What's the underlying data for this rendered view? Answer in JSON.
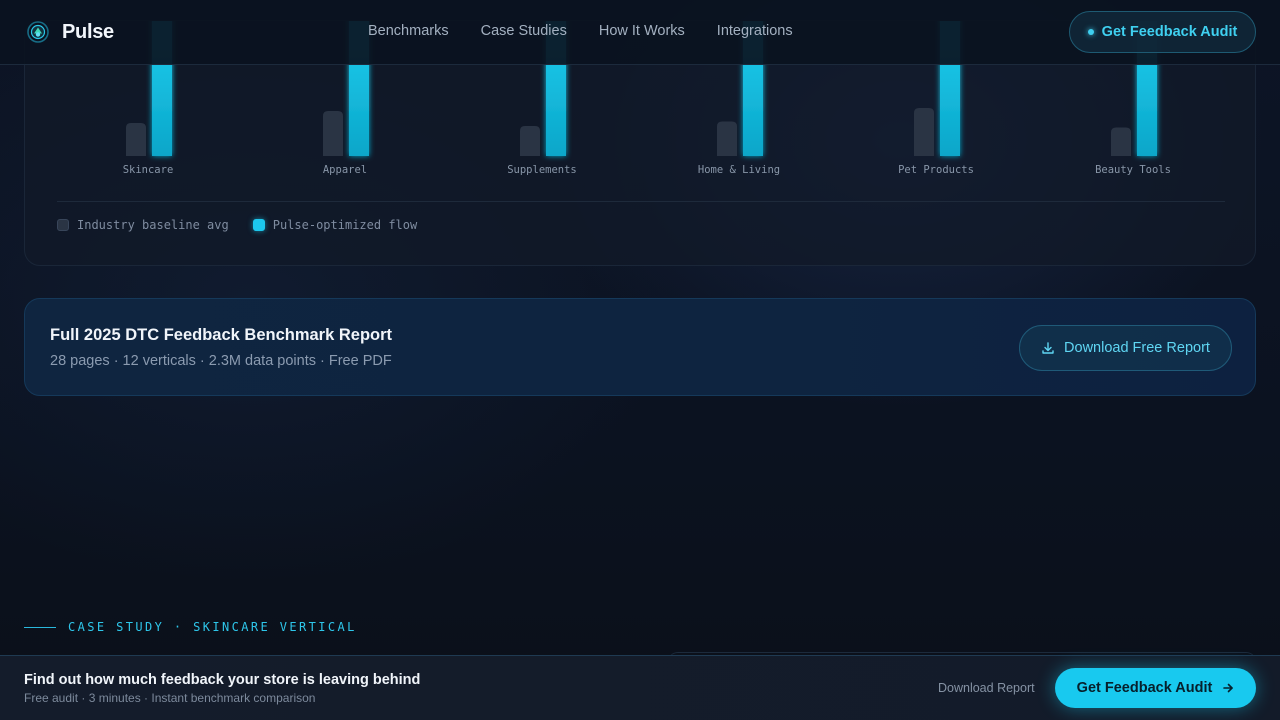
{
  "nav": {
    "brand": "Pulse",
    "links": [
      "Benchmarks",
      "Case Studies",
      "How It Works",
      "Integrations"
    ],
    "cta_label": "Get Feedback Audit"
  },
  "chart_data": {
    "type": "bar",
    "categories": [
      "Skincare",
      "Apparel",
      "Supplements",
      "Home & Living",
      "Pet Products",
      "Beauty Tools"
    ],
    "series": [
      {
        "name": "Industry baseline avg",
        "values": [
          22,
          30,
          20,
          23,
          32,
          19
        ],
        "color": "#2a3444"
      },
      {
        "name": "Pulse-optimized flow",
        "values": [
          100,
          100,
          100,
          100,
          100,
          100
        ],
        "color": "#1cc8ee"
      }
    ],
    "legend": [
      "Industry baseline avg",
      "Pulse-optimized flow"
    ],
    "legend_position": "bottom-left",
    "note": "bar tops cropped by the sticky header"
  },
  "report": {
    "title": "Full 2025 DTC Feedback Benchmark Report",
    "meta": "28 pages · 12 verticals · 2.3M data points · Free PDF",
    "button_label": "Download Free Report",
    "button_icon": "download-icon"
  },
  "case_study": {
    "eyebrow": "CASE STUDY · SKINCARE VERTICAL"
  },
  "bottom_bar": {
    "title": "Find out how much feedback your store is leaving behind",
    "subtitle": "Free audit · 3 minutes · Instant benchmark comparison",
    "link_label": "Download Report",
    "cta_label": "Get Feedback Audit",
    "cta_icon": "arrow-right-icon"
  },
  "colors": {
    "accent": "#1cc8ee",
    "background": "#0c1320",
    "baseline_bar": "#2a3444"
  }
}
